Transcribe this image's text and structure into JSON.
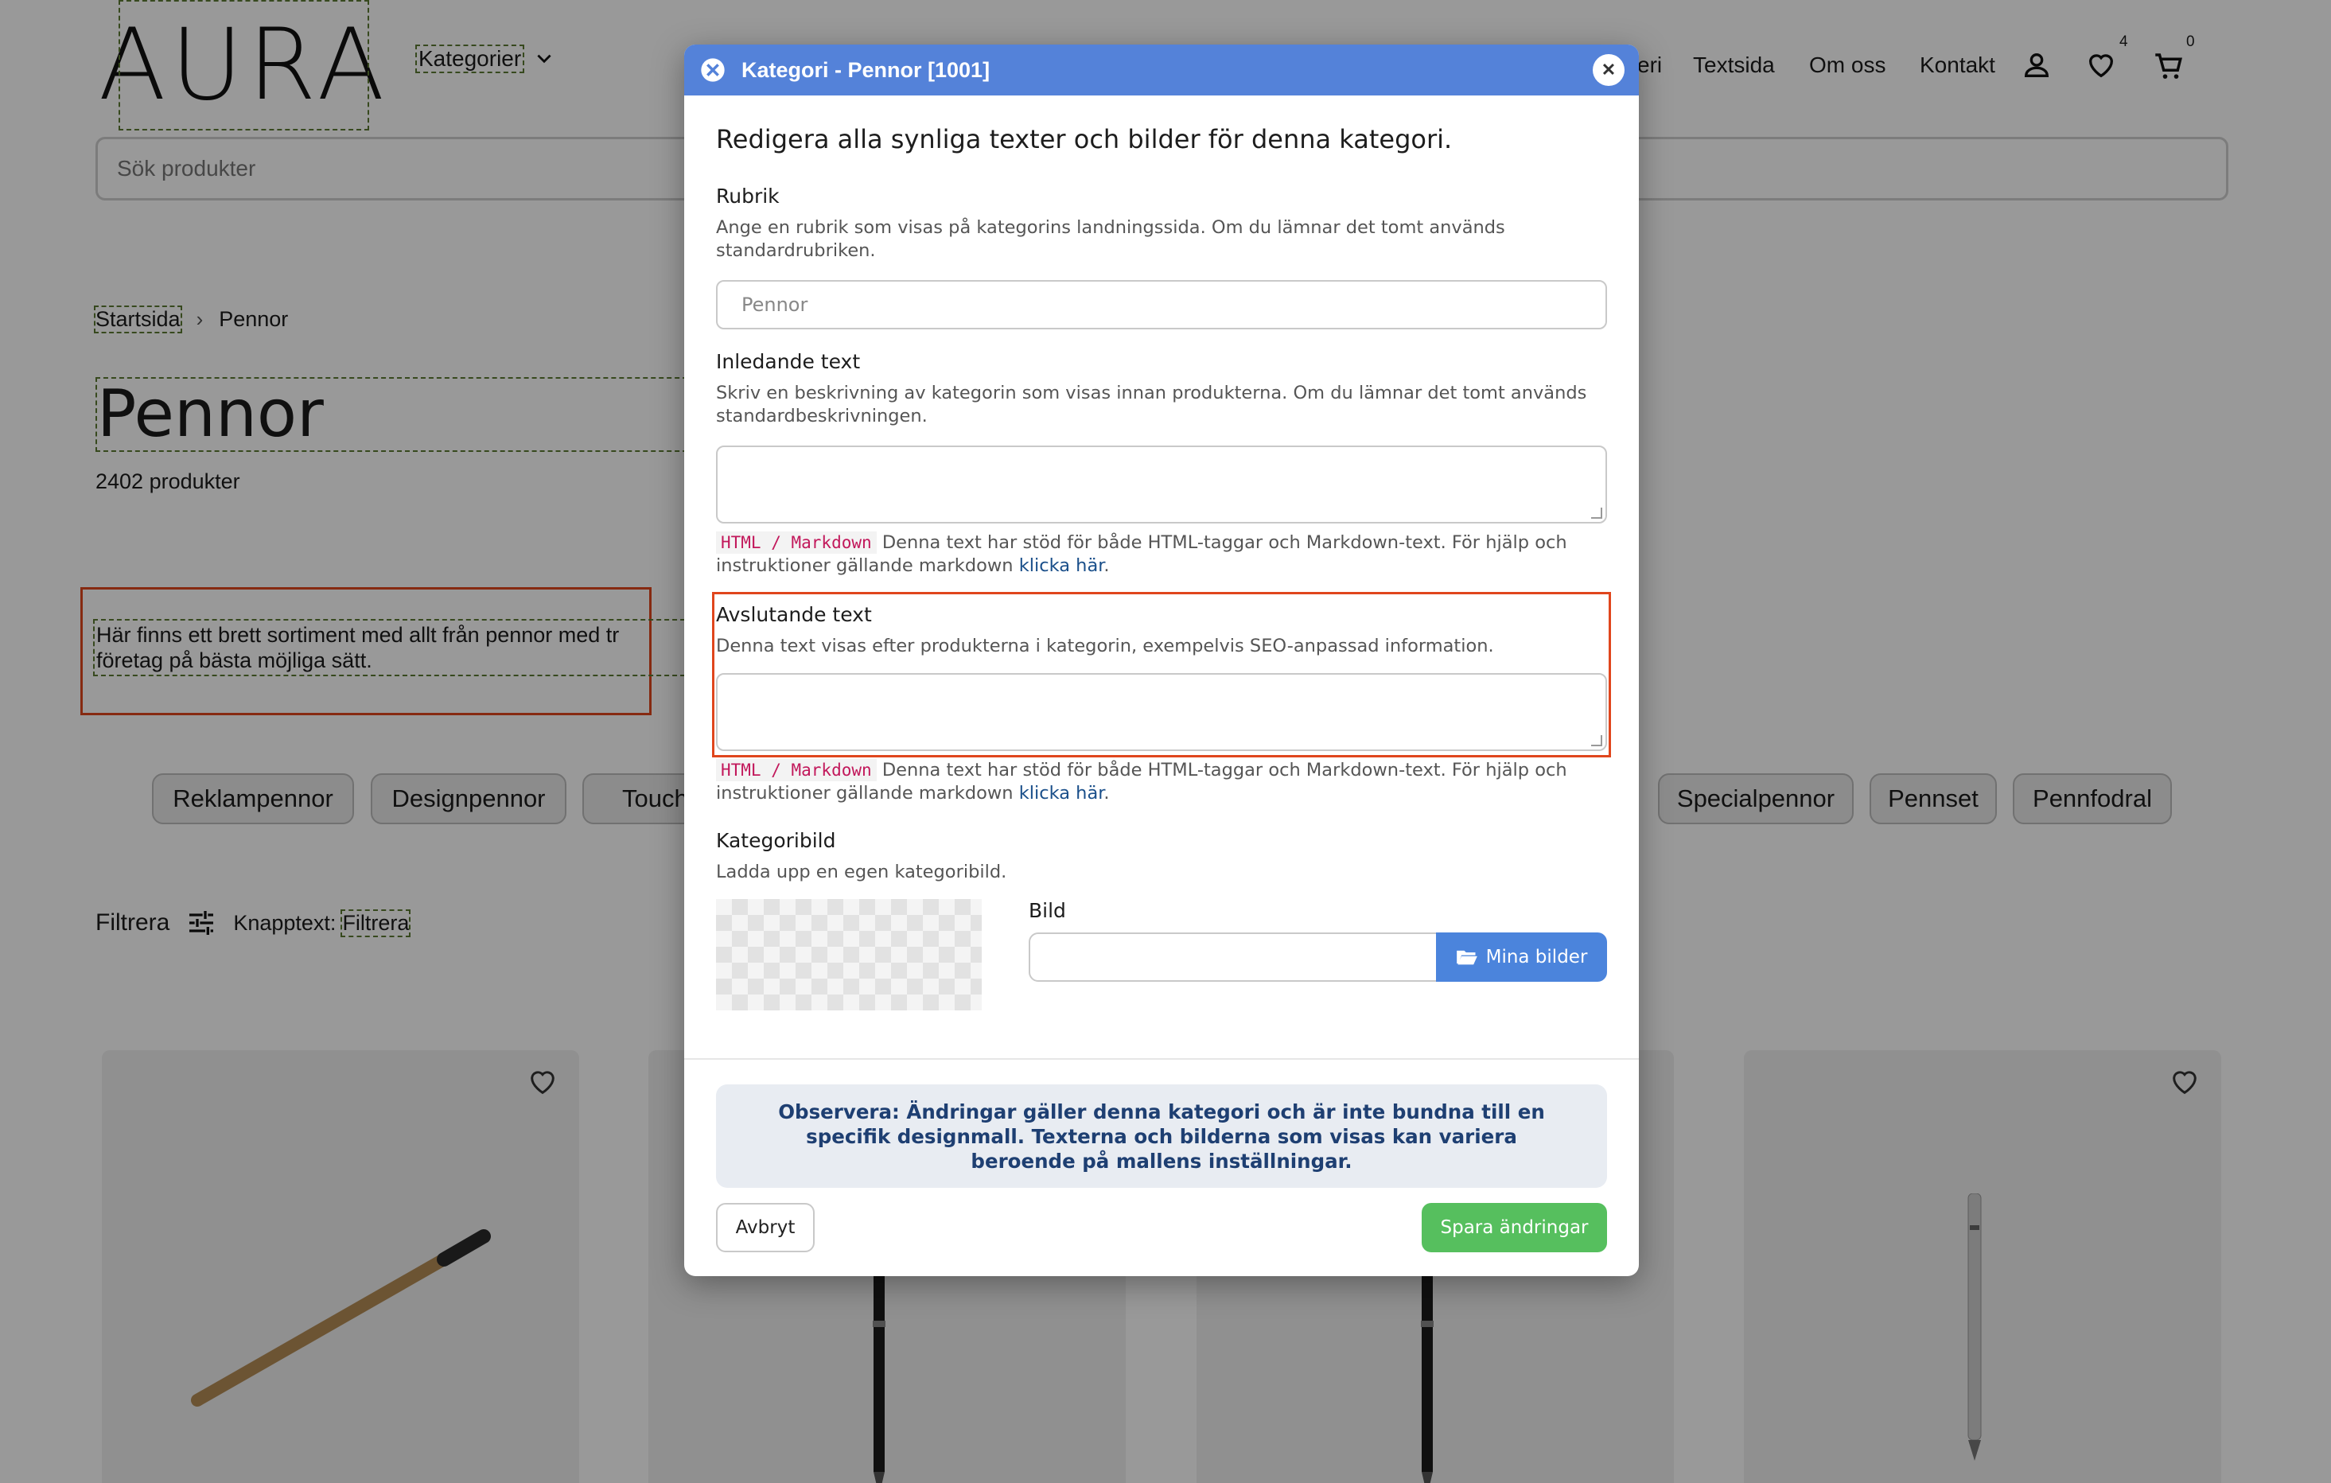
{
  "header": {
    "logo": "AURA",
    "categories_label": "Kategorier",
    "nav": [
      "eri",
      "Textsida",
      "Om oss",
      "Kontakt"
    ],
    "wishlist_count": "4",
    "cart_count": "0"
  },
  "search": {
    "placeholder": "Sök produkter"
  },
  "breadcrumb": {
    "home": "Startsida",
    "current": "Pennor"
  },
  "category": {
    "title": "Pennor",
    "count": "2402 produkter",
    "description_line1": "Här finns ett brett sortiment med allt från pennor med tr",
    "description_line2": "företag på bästa möjliga sätt."
  },
  "pills": [
    "Reklampennor",
    "Designpennor",
    "Touchp",
    "Specialpennor",
    "Pennset",
    "Pennfodral"
  ],
  "filter": {
    "label": "Filtrera",
    "button_prefix": "Knapptext:",
    "button_value": "Filtrera"
  },
  "modal": {
    "title": "Kategori - Pennor [1001]",
    "heading": "Redigera alla synliga texter och bilder för denna kategori.",
    "rubrik_label": "Rubrik",
    "rubrik_help": "Ange en rubrik som visas på kategorins landningssida. Om du lämnar det tomt används standardrubriken.",
    "rubrik_placeholder": "Pennor",
    "intro_label": "Inledande text",
    "intro_help": "Skriv en beskrivning av kategorin som visas innan produkterna. Om du lämnar det tomt används standardbeskrivningen.",
    "markdown_tag": "HTML / Markdown",
    "markdown_help": "Denna text har stöd för både HTML-taggar och Markdown-text. För hjälp och instruktioner gällande markdown",
    "markdown_link": "klicka här",
    "closing_label": "Avslutande text",
    "closing_help": "Denna text visas efter produkterna i kategorin, exempelvis SEO-anpassad information.",
    "image_label": "Kategoribild",
    "image_help": "Ladda upp en egen kategoribild.",
    "bild_label": "Bild",
    "my_images_button": "Mina bilder",
    "note": "Observera: Ändringar gäller denna kategori och är inte bundna till en specifik designmall. Texterna och bilderna som visas kan variera beroende på mallens inställningar.",
    "cancel_button": "Avbryt",
    "save_button": "Spara ändringar"
  },
  "colors": {
    "modal_header": "#5482d9",
    "save": "#56bf5e",
    "highlight": "#e0461d",
    "note_bg": "#e8ecf2"
  }
}
